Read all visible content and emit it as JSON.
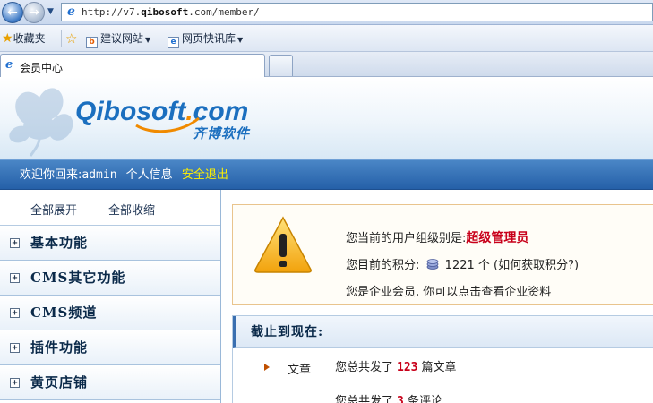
{
  "browser": {
    "address": {
      "prefix": "http://v7.",
      "host": "qibosoft",
      "suffix": ".com/member/"
    },
    "favorites": {
      "label": "收藏夹",
      "items": [
        {
          "label": "建议网站"
        },
        {
          "label": "网页快讯库"
        }
      ]
    },
    "tab": {
      "title": "会员中心"
    }
  },
  "header": {
    "logo_main": "Qibosoft",
    "logo_dot": ".",
    "logo_tld": "com",
    "logo_cn": "齐博软件"
  },
  "userbar": {
    "welcome": "欢迎你回来:",
    "username": "admin",
    "profile": "个人信息",
    "logout": "安全退出"
  },
  "sidebar": {
    "expand_all": "全部展开",
    "collapse_all": "全部收缩",
    "items": [
      {
        "label": "基本功能"
      },
      {
        "label": "CMS其它功能"
      },
      {
        "label": "CMS频道"
      },
      {
        "label": "插件功能"
      },
      {
        "label": "黄页店铺"
      }
    ]
  },
  "notice": {
    "group_prefix": "您当前的用户组级别是:",
    "group_name": "超级管理员",
    "points_prefix": "您目前的积分:",
    "points_value": "1221",
    "points_suffix": "个 (如何获取积分?)",
    "company_line": "您是企业会员, 你可以点击查看企业资料"
  },
  "stats": {
    "title": "截止到现在:",
    "rows": [
      {
        "label": "文章",
        "prefix": "您总共发了",
        "count": "123",
        "suffix": "篇文章"
      },
      {
        "label": "",
        "prefix": "您总共发了",
        "count": "3",
        "suffix": "条评论"
      }
    ]
  },
  "colors": {
    "accent_blue": "#2560a8",
    "highlight_red": "#c8001a",
    "logout_yellow": "#fff000"
  }
}
